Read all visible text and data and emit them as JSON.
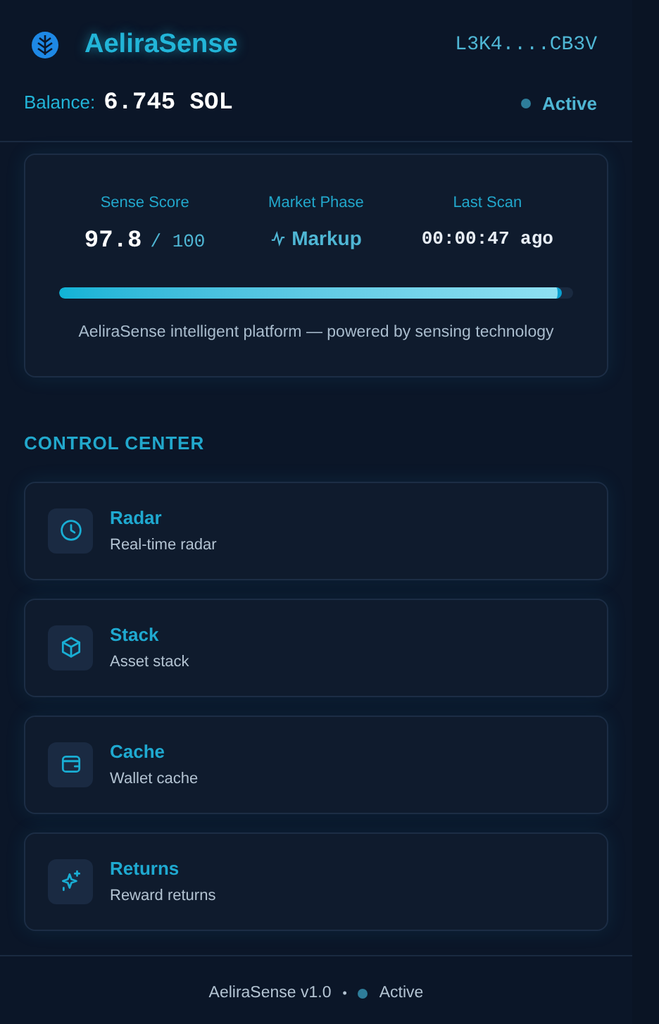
{
  "header": {
    "brand": "AeliraSense",
    "wallet": "L3K4....CB3V",
    "balance_label": "Balance:",
    "balance": "6.745 SOL",
    "status": "Active"
  },
  "summary": {
    "score_label": "Sense Score",
    "score": "97.8",
    "score_max": "/ 100",
    "phase_label": "Market Phase",
    "phase": "Markup",
    "scan_label": "Last Scan",
    "scan": "00:00:47 ago",
    "level": 0.978,
    "tagline": "AeliraSense intelligent platform — powered by sensing technology"
  },
  "section_title": "CONTROL CENTER",
  "items": [
    {
      "kind": "clock",
      "title": "Radar",
      "subtitle": "Real-time radar"
    },
    {
      "kind": "box",
      "title": "Stack",
      "subtitle": "Asset stack"
    },
    {
      "kind": "wallet",
      "title": "Cache",
      "subtitle": "Wallet cache"
    },
    {
      "kind": "sparkles",
      "title": "Returns",
      "subtitle": "Reward returns"
    }
  ],
  "footer": {
    "version": "AeliraSense v1.0",
    "separator": "•",
    "status": "Active"
  }
}
